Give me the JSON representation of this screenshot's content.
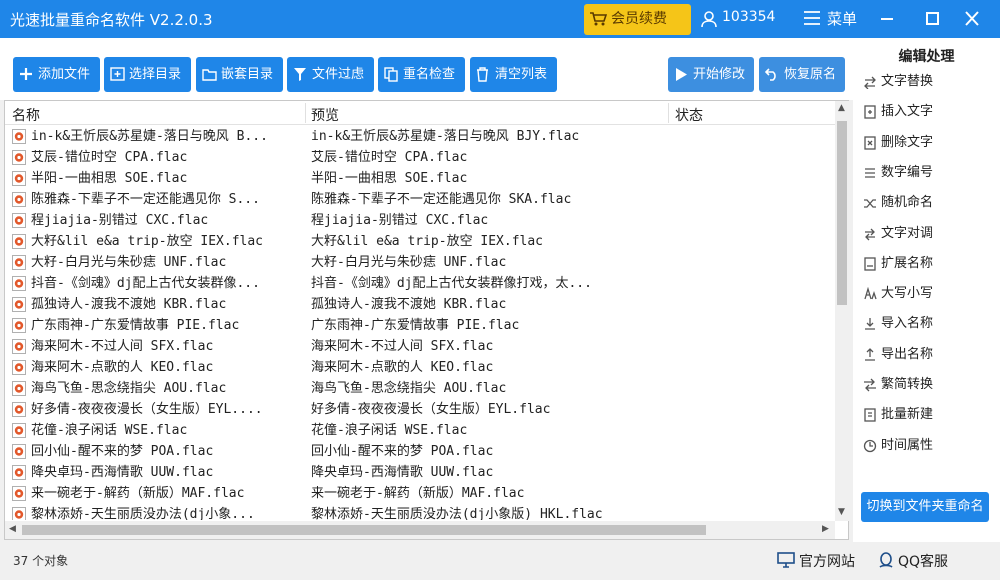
{
  "window": {
    "title": "光速批量重命名软件 V2.2.0.3"
  },
  "header": {
    "vip_label": "会员续费",
    "user_id": "103354",
    "menu_label": "菜单"
  },
  "toolbar": {
    "add_file": "添加文件",
    "select_dir": "选择目录",
    "nested_dir": "嵌套目录",
    "file_filter": "文件过虑",
    "rename_check": "重名检查",
    "clear_list": "清空列表",
    "start_modify": "开始修改",
    "restore_name": "恢复原名"
  },
  "table": {
    "columns": [
      "名称",
      "预览",
      "状态"
    ],
    "rows": [
      [
        "in-k&王忻辰&苏星婕-落日与晚风 B...",
        "in-k&王忻辰&苏星婕-落日与晚风 BJY.flac"
      ],
      [
        "艾辰-错位时空 CPA.flac",
        "艾辰-错位时空 CPA.flac"
      ],
      [
        "半阳-一曲相思 SOE.flac",
        "半阳-一曲相思 SOE.flac"
      ],
      [
        "陈雅森-下辈子不一定还能遇见你 S...",
        "陈雅森-下辈子不一定还能遇见你 SKA.flac"
      ],
      [
        "程jiajia-别错过 CXC.flac",
        "程jiajia-别错过 CXC.flac"
      ],
      [
        "大籽&lil e&a trip-放空 IEX.flac",
        "大籽&lil e&a trip-放空 IEX.flac"
      ],
      [
        "大籽-白月光与朱砂痣 UNF.flac",
        "大籽-白月光与朱砂痣 UNF.flac"
      ],
      [
        "抖音-《剑魂》dj配上古代女装群像...",
        "抖音-《剑魂》dj配上古代女装群像打戏，太..."
      ],
      [
        "孤独诗人-渡我不渡她 KBR.flac",
        "孤独诗人-渡我不渡她 KBR.flac"
      ],
      [
        "广东雨神-广东爱情故事 PIE.flac",
        "广东雨神-广东爱情故事 PIE.flac"
      ],
      [
        "海来阿木-不过人间 SFX.flac",
        "海来阿木-不过人间 SFX.flac"
      ],
      [
        "海来阿木-点歌的人 KEO.flac",
        "海来阿木-点歌的人 KEO.flac"
      ],
      [
        "海鸟飞鱼-思念绕指尖 AOU.flac",
        "海鸟飞鱼-思念绕指尖 AOU.flac"
      ],
      [
        "好多倩-夜夜夜漫长（女生版）EYL....",
        "好多倩-夜夜夜漫长（女生版）EYL.flac"
      ],
      [
        "花僮-浪子闲话 WSE.flac",
        "花僮-浪子闲话 WSE.flac"
      ],
      [
        "回小仙-醒不来的梦 POA.flac",
        "回小仙-醒不来的梦 POA.flac"
      ],
      [
        "降央卓玛-西海情歌 UUW.flac",
        "降央卓玛-西海情歌 UUW.flac"
      ],
      [
        "来一碗老于-解药（新版）MAF.flac",
        "来一碗老于-解药（新版）MAF.flac"
      ],
      [
        "黎林添娇-天生丽质没办法(dj小象...",
        "黎林添娇-天生丽质没办法(dj小象版) HKL.flac"
      ]
    ]
  },
  "status": {
    "count_text": "37 个对象",
    "website": "官方网站",
    "qq_service": "QQ客服"
  },
  "sidebar": {
    "title": "编辑处理",
    "items": [
      "文字替换",
      "插入文字",
      "删除文字",
      "数字编号",
      "随机命名",
      "文字对调",
      "扩展名称",
      "大写小写",
      "导入名称",
      "导出名称",
      "繁简转换",
      "批量新建",
      "时间属性"
    ],
    "switch_label": "切换到文件夹重命名"
  },
  "colors": {
    "primary": "#1f86e8",
    "vip": "#f5c518",
    "background": "#f0f0f0"
  },
  "icons": {
    "toolbar": [
      "plus-icon",
      "folder-add-icon",
      "folder-tree-icon",
      "funnel-icon",
      "copy-icon",
      "trash-icon",
      "play-icon",
      "undo-icon"
    ],
    "file": "audio-file-icon"
  }
}
